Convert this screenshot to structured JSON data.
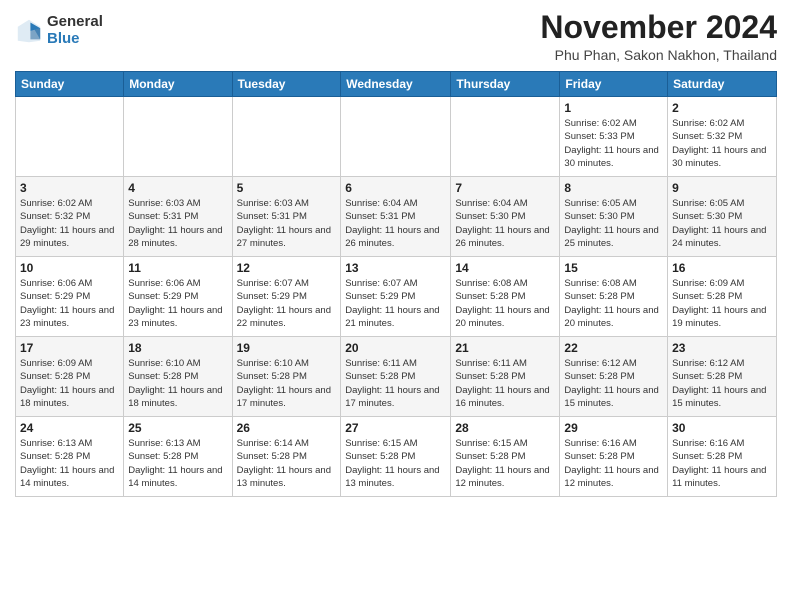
{
  "logo": {
    "general": "General",
    "blue": "Blue"
  },
  "header": {
    "month": "November 2024",
    "location": "Phu Phan, Sakon Nakhon, Thailand"
  },
  "days_of_week": [
    "Sunday",
    "Monday",
    "Tuesday",
    "Wednesday",
    "Thursday",
    "Friday",
    "Saturday"
  ],
  "weeks": [
    [
      {
        "day": "",
        "info": ""
      },
      {
        "day": "",
        "info": ""
      },
      {
        "day": "",
        "info": ""
      },
      {
        "day": "",
        "info": ""
      },
      {
        "day": "",
        "info": ""
      },
      {
        "day": "1",
        "info": "Sunrise: 6:02 AM\nSunset: 5:33 PM\nDaylight: 11 hours and 30 minutes."
      },
      {
        "day": "2",
        "info": "Sunrise: 6:02 AM\nSunset: 5:32 PM\nDaylight: 11 hours and 30 minutes."
      }
    ],
    [
      {
        "day": "3",
        "info": "Sunrise: 6:02 AM\nSunset: 5:32 PM\nDaylight: 11 hours and 29 minutes."
      },
      {
        "day": "4",
        "info": "Sunrise: 6:03 AM\nSunset: 5:31 PM\nDaylight: 11 hours and 28 minutes."
      },
      {
        "day": "5",
        "info": "Sunrise: 6:03 AM\nSunset: 5:31 PM\nDaylight: 11 hours and 27 minutes."
      },
      {
        "day": "6",
        "info": "Sunrise: 6:04 AM\nSunset: 5:31 PM\nDaylight: 11 hours and 26 minutes."
      },
      {
        "day": "7",
        "info": "Sunrise: 6:04 AM\nSunset: 5:30 PM\nDaylight: 11 hours and 26 minutes."
      },
      {
        "day": "8",
        "info": "Sunrise: 6:05 AM\nSunset: 5:30 PM\nDaylight: 11 hours and 25 minutes."
      },
      {
        "day": "9",
        "info": "Sunrise: 6:05 AM\nSunset: 5:30 PM\nDaylight: 11 hours and 24 minutes."
      }
    ],
    [
      {
        "day": "10",
        "info": "Sunrise: 6:06 AM\nSunset: 5:29 PM\nDaylight: 11 hours and 23 minutes."
      },
      {
        "day": "11",
        "info": "Sunrise: 6:06 AM\nSunset: 5:29 PM\nDaylight: 11 hours and 23 minutes."
      },
      {
        "day": "12",
        "info": "Sunrise: 6:07 AM\nSunset: 5:29 PM\nDaylight: 11 hours and 22 minutes."
      },
      {
        "day": "13",
        "info": "Sunrise: 6:07 AM\nSunset: 5:29 PM\nDaylight: 11 hours and 21 minutes."
      },
      {
        "day": "14",
        "info": "Sunrise: 6:08 AM\nSunset: 5:28 PM\nDaylight: 11 hours and 20 minutes."
      },
      {
        "day": "15",
        "info": "Sunrise: 6:08 AM\nSunset: 5:28 PM\nDaylight: 11 hours and 20 minutes."
      },
      {
        "day": "16",
        "info": "Sunrise: 6:09 AM\nSunset: 5:28 PM\nDaylight: 11 hours and 19 minutes."
      }
    ],
    [
      {
        "day": "17",
        "info": "Sunrise: 6:09 AM\nSunset: 5:28 PM\nDaylight: 11 hours and 18 minutes."
      },
      {
        "day": "18",
        "info": "Sunrise: 6:10 AM\nSunset: 5:28 PM\nDaylight: 11 hours and 18 minutes."
      },
      {
        "day": "19",
        "info": "Sunrise: 6:10 AM\nSunset: 5:28 PM\nDaylight: 11 hours and 17 minutes."
      },
      {
        "day": "20",
        "info": "Sunrise: 6:11 AM\nSunset: 5:28 PM\nDaylight: 11 hours and 17 minutes."
      },
      {
        "day": "21",
        "info": "Sunrise: 6:11 AM\nSunset: 5:28 PM\nDaylight: 11 hours and 16 minutes."
      },
      {
        "day": "22",
        "info": "Sunrise: 6:12 AM\nSunset: 5:28 PM\nDaylight: 11 hours and 15 minutes."
      },
      {
        "day": "23",
        "info": "Sunrise: 6:12 AM\nSunset: 5:28 PM\nDaylight: 11 hours and 15 minutes."
      }
    ],
    [
      {
        "day": "24",
        "info": "Sunrise: 6:13 AM\nSunset: 5:28 PM\nDaylight: 11 hours and 14 minutes."
      },
      {
        "day": "25",
        "info": "Sunrise: 6:13 AM\nSunset: 5:28 PM\nDaylight: 11 hours and 14 minutes."
      },
      {
        "day": "26",
        "info": "Sunrise: 6:14 AM\nSunset: 5:28 PM\nDaylight: 11 hours and 13 minutes."
      },
      {
        "day": "27",
        "info": "Sunrise: 6:15 AM\nSunset: 5:28 PM\nDaylight: 11 hours and 13 minutes."
      },
      {
        "day": "28",
        "info": "Sunrise: 6:15 AM\nSunset: 5:28 PM\nDaylight: 11 hours and 12 minutes."
      },
      {
        "day": "29",
        "info": "Sunrise: 6:16 AM\nSunset: 5:28 PM\nDaylight: 11 hours and 12 minutes."
      },
      {
        "day": "30",
        "info": "Sunrise: 6:16 AM\nSunset: 5:28 PM\nDaylight: 11 hours and 11 minutes."
      }
    ]
  ]
}
